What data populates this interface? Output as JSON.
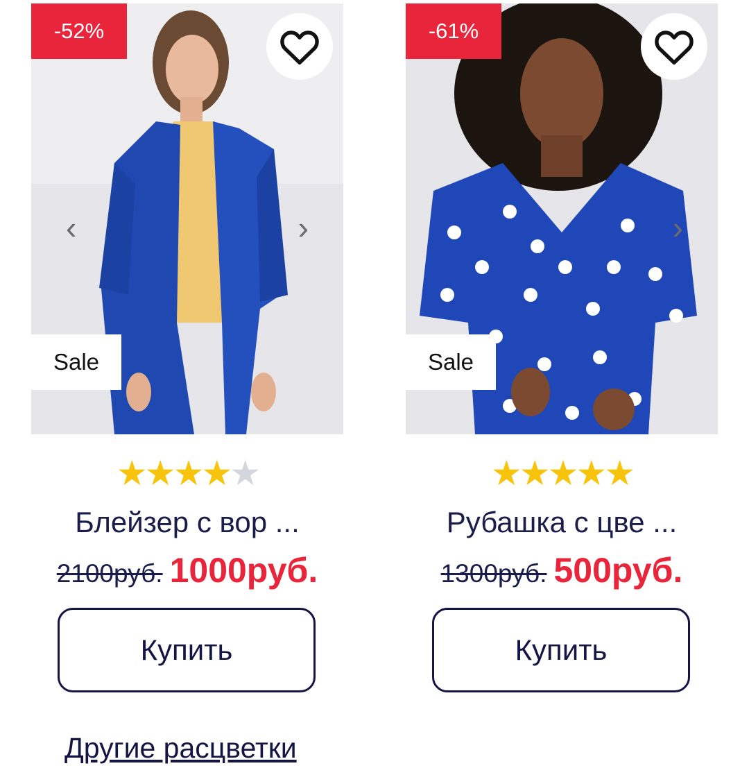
{
  "products": [
    {
      "discount": "-52%",
      "badge": "Sale",
      "rating": 4,
      "rating_max": 5,
      "title": "Блейзер с вор ...",
      "old_price": "2100руб.",
      "new_price": "1000руб.",
      "buy_label": "Купить",
      "colors_link": "Другие расцветки",
      "prev_icon": "‹",
      "next_icon": "›"
    },
    {
      "discount": "-61%",
      "badge": "Sale",
      "rating": 5,
      "rating_max": 5,
      "title": "Рубашка с цве ...",
      "old_price": "1300руб.",
      "new_price": "500руб.",
      "buy_label": "Купить",
      "next_icon": "›"
    }
  ],
  "colors": {
    "accent_red": "#e8253a",
    "navy": "#141544",
    "star_on": "#f8c40b",
    "star_off": "#d3d6dc"
  }
}
